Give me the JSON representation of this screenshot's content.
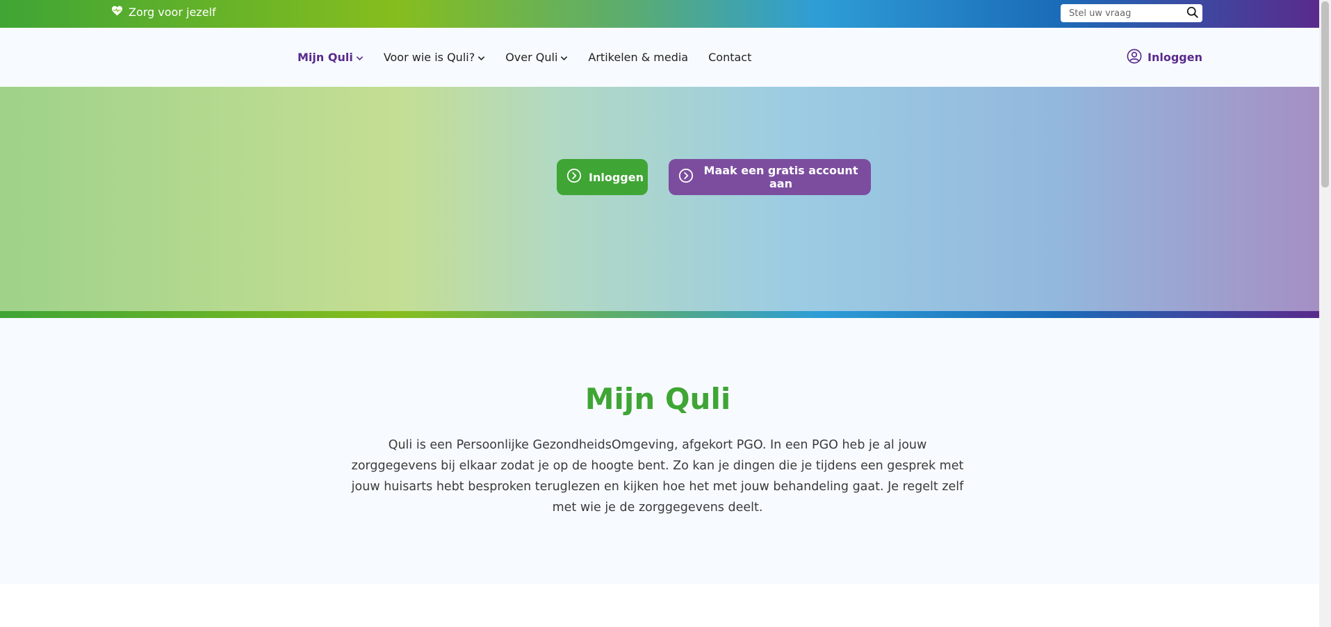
{
  "topbar": {
    "tagline": "Zorg voor jezelf",
    "search": {
      "placeholder": "Stel uw vraag",
      "value": ""
    }
  },
  "nav": {
    "items": [
      {
        "label": "Mijn Quli",
        "dropdown": true,
        "active": true
      },
      {
        "label": "Voor wie is Quli?",
        "dropdown": true
      },
      {
        "label": "Over Quli",
        "dropdown": true
      },
      {
        "label": "Artikelen & media",
        "dropdown": false
      },
      {
        "label": "Contact",
        "dropdown": false
      }
    ],
    "login_label": "Inloggen"
  },
  "hero": {
    "login_button": "Inloggen",
    "register_button": "Maak een gratis account aan"
  },
  "section": {
    "title": "Mijn Quli",
    "text": "Quli is een Persoonlijke GezondheidsOmgeving, afgekort PGO. In een PGO heb je al jouw zorggegevens bij elkaar zodat je op de hoogte bent. Zo kan je dingen die je tijdens een gesprek met jouw huisarts hebt besproken teruglezen en kijken hoe het met jouw behandeling gaat. Je regelt zelf met wie je de zorggegevens deelt."
  },
  "colors": {
    "brand_green": "#3fa535",
    "brand_purple": "#5a2a8c",
    "button_purple": "#7c4d9f"
  },
  "icons": {
    "tagline": "heart-pulse-icon",
    "search": "search-icon",
    "nav_dropdown": "chevron-down-icon",
    "login": "user-circle-icon",
    "buttons": "arrow-circle-right-icon"
  }
}
